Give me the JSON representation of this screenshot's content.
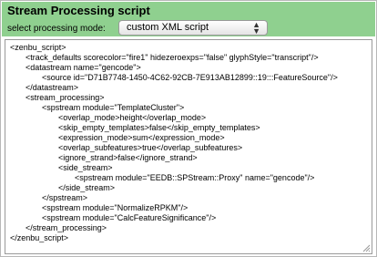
{
  "header": {
    "title": "Stream Processing script",
    "mode_label": "select processing mode:",
    "mode_value": "custom XML script"
  },
  "editor": {
    "lines": [
      "<zenbu_script>",
      "<track_defaults scorecolor=\"fire1\" hidezeroexps=\"false\" glyphStyle=\"transcript\"/>",
      "<datastream name=\"gencode\">",
      "<source id=\"D71B7748-1450-4C62-92CB-7E913AB12899::19:::FeatureSource\"/>",
      "</datastream>",
      "<stream_processing>",
      "<spstream module=\"TemplateCluster\">",
      "<overlap_mode>height</overlap_mode>",
      "<skip_empty_templates>false</skip_empty_templates>",
      "<expression_mode>sum</expression_mode>",
      "<overlap_subfeatures>true</overlap_subfeatures>",
      "<ignore_strand>false</ignore_strand>",
      "<side_stream>",
      "<spstream module=\"EEDB::SPStream::Proxy\" name=\"gencode\"/>",
      "</side_stream>",
      "</spstream>",
      "<spstream module=\"NormalizeRPKM\"/>",
      "<spstream module=\"CalcFeatureSignificance\"/>",
      "</stream_processing>",
      "</zenbu_script>"
    ]
  }
}
